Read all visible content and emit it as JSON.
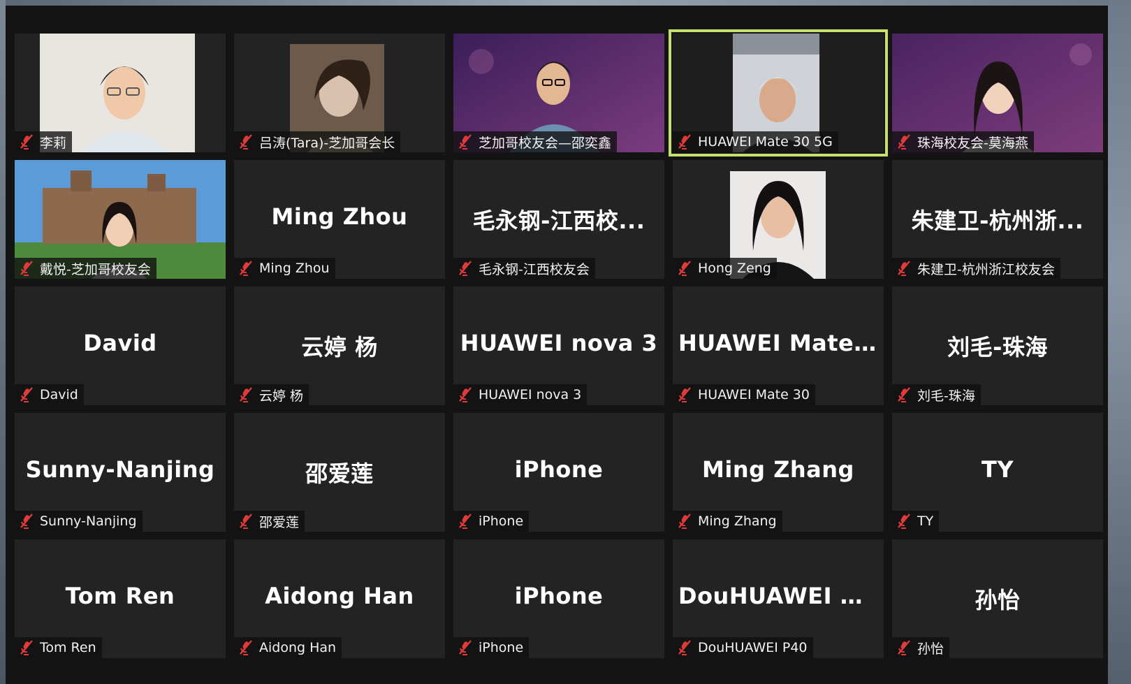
{
  "app": {
    "colors": {
      "tile_bg": "#232323",
      "active_border": "#c7e06b",
      "muted_icon": "#e03b3b",
      "text": "#ffffff"
    },
    "icons": {
      "muted": "microphone-off-icon"
    }
  },
  "participants": [
    {
      "label": "李莉",
      "big_name": "",
      "video": "photo-woman-glasses",
      "active": false
    },
    {
      "label": "吕涛(Tara)-芝加哥会长",
      "big_name": "",
      "video": "photo-woman-sepia",
      "active": false
    },
    {
      "label": "芝加哥校友会—邵奕鑫",
      "big_name": "",
      "video": "photo-man-purple-bg",
      "active": false
    },
    {
      "label": "HUAWEI Mate 30 5G",
      "big_name": "",
      "video": "photo-elderly-man",
      "active": true
    },
    {
      "label": "珠海校友会-莫海燕",
      "big_name": "",
      "video": "photo-young-woman-purple-bg",
      "active": false
    },
    {
      "label": "戴悦-芝加哥校友会",
      "big_name": "",
      "video": "photo-campus-woman",
      "active": false
    },
    {
      "label": "Ming Zhou",
      "big_name": "Ming Zhou",
      "video": "",
      "active": false
    },
    {
      "label": "毛永钢-江西校友会",
      "big_name": "毛永钢-江西校...",
      "video": "",
      "active": false
    },
    {
      "label": "Hong Zeng",
      "big_name": "",
      "video": "photo-woman-smiling",
      "active": false
    },
    {
      "label": "朱建卫-杭州浙江校友会",
      "big_name": "朱建卫-杭州浙...",
      "video": "",
      "active": false
    },
    {
      "label": "David",
      "big_name": "David",
      "video": "",
      "active": false
    },
    {
      "label": "云婷 杨",
      "big_name": "云婷 杨",
      "video": "",
      "active": false
    },
    {
      "label": "HUAWEI nova 3",
      "big_name": "HUAWEI nova 3",
      "video": "",
      "active": false
    },
    {
      "label": "HUAWEI Mate 30",
      "big_name": "HUAWEI Mate 30",
      "video": "",
      "active": false
    },
    {
      "label": "刘毛-珠海",
      "big_name": "刘毛-珠海",
      "video": "",
      "active": false
    },
    {
      "label": "Sunny-Nanjing",
      "big_name": "Sunny-Nanjing",
      "video": "",
      "active": false
    },
    {
      "label": "邵爱莲",
      "big_name": "邵爱莲",
      "video": "",
      "active": false
    },
    {
      "label": "iPhone",
      "big_name": "iPhone",
      "video": "",
      "active": false
    },
    {
      "label": "Ming Zhang",
      "big_name": "Ming Zhang",
      "video": "",
      "active": false
    },
    {
      "label": "TY",
      "big_name": "TY",
      "video": "",
      "active": false
    },
    {
      "label": "Tom Ren",
      "big_name": "Tom Ren",
      "video": "",
      "active": false
    },
    {
      "label": "Aidong Han",
      "big_name": "Aidong Han",
      "video": "",
      "active": false
    },
    {
      "label": "iPhone",
      "big_name": "iPhone",
      "video": "",
      "active": false
    },
    {
      "label": "DouHUAWEI P40",
      "big_name": "DouHUAWEI P40",
      "video": "",
      "active": false
    },
    {
      "label": "孙怡",
      "big_name": "孙怡",
      "video": "",
      "active": false
    }
  ]
}
